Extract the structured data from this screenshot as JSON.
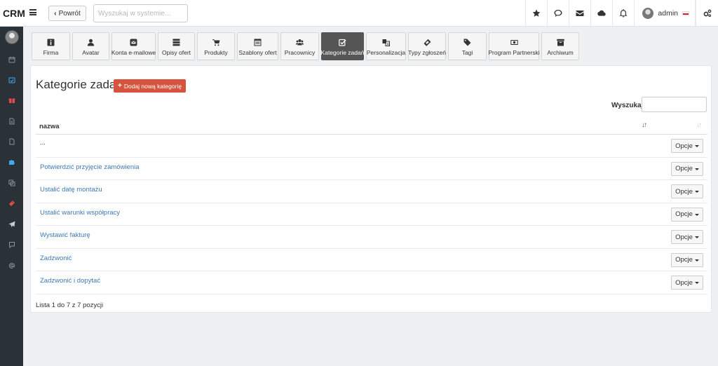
{
  "topbar": {
    "brand": "CRM",
    "back_label": "Powrót",
    "search_placeholder": "Wyszukaj w systemie...",
    "icons": [
      "star-icon",
      "chat-icon",
      "envelope-icon",
      "cloud-icon",
      "bell-icon"
    ],
    "username": "admin"
  },
  "sidebar": {
    "icons": [
      "calendar-icon",
      "calendar-check-icon",
      "gift-icon",
      "document-icon",
      "file-icon",
      "puzzle-icon",
      "copy-icon",
      "ticket-icon",
      "paper-plane-icon",
      "chat-square-icon",
      "at-icon"
    ],
    "accent_colors": {
      "calendar-check-icon": "#3fa9f5",
      "gift-icon": "#e64b4b",
      "puzzle-icon": "#3fa9f5",
      "ticket-icon": "#e64b4b"
    }
  },
  "tabs": [
    {
      "label": "Firma",
      "icon": "info-icon",
      "active": false
    },
    {
      "label": "Avatar",
      "icon": "user-icon",
      "active": false
    },
    {
      "label": "Konta e-mailowe",
      "icon": "envelope-square-icon",
      "active": false
    },
    {
      "label": "Opisy ofert",
      "icon": "server-icon",
      "active": false
    },
    {
      "label": "Produkty",
      "icon": "cart-icon",
      "active": false
    },
    {
      "label": "Szablony ofert",
      "icon": "window-icon",
      "active": false
    },
    {
      "label": "Pracownicy",
      "icon": "users-icon",
      "active": false
    },
    {
      "label": "Kategorie zadań",
      "icon": "checkbox-icon",
      "active": true
    },
    {
      "label": "Personalizacja",
      "icon": "language-icon",
      "active": false
    },
    {
      "label": "Typy zgłoszeń",
      "icon": "ticket-icon",
      "active": false
    },
    {
      "label": "Tagi",
      "icon": "tags-icon",
      "active": false
    },
    {
      "label": "Program Partnerski",
      "icon": "money-icon",
      "active": false
    },
    {
      "label": "Archiwum",
      "icon": "archive-icon",
      "active": false
    }
  ],
  "main": {
    "title": "Kategorie zadań",
    "add_button": "Dodaj nową kategorię",
    "filter_label": "Wyszukaj:",
    "filter_value": "",
    "column_name": "nazwa",
    "rows": [
      "...",
      "Potwierdzić przyjęcie zamówienia",
      "Ustalić datę montażu",
      "Ustalić warunki współpracy",
      "Wystawić fakturę",
      "Zadzwonić",
      "Zadzwonić i dopytać"
    ],
    "options_label": "Opcje",
    "info": "Lista 1 do 7 z 7 pozycji"
  },
  "colors": {
    "accent_add": "#d5533f",
    "link": "#3c7ab5",
    "active_tab": "#555555",
    "sidebar_bg": "#2a3137"
  }
}
